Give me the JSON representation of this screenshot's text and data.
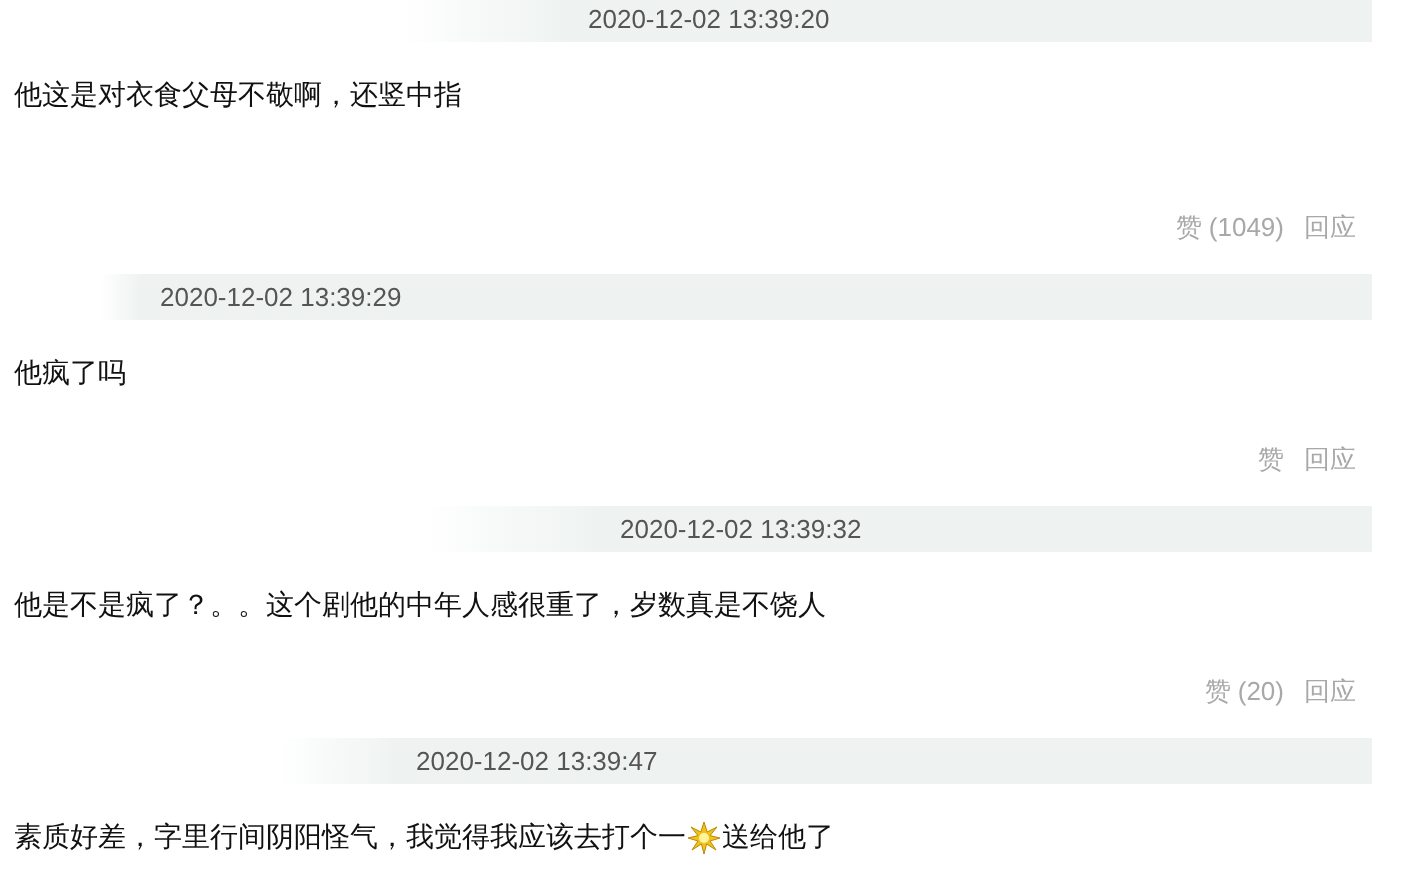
{
  "comments": [
    {
      "time": "2020-12-02 13:39:20",
      "segments": [
        {
          "kind": "text",
          "text": "他这是对衣食父母不敬啊，还竖中指"
        }
      ],
      "likes": "赞 (1049)",
      "reply": "回应"
    },
    {
      "time": "2020-12-02 13:39:29",
      "segments": [
        {
          "kind": "text",
          "text": "他疯了吗"
        }
      ],
      "likes": "赞",
      "reply": "回应"
    },
    {
      "time": "2020-12-02 13:39:32",
      "segments": [
        {
          "kind": "text",
          "text": "他是不是疯了？。。这个剧他的中年人感很重了，岁数真是不饶人"
        }
      ],
      "likes": "赞 (20)",
      "reply": "回应"
    },
    {
      "time": "2020-12-02 13:39:47",
      "segments": [
        {
          "kind": "text",
          "text": "素质好差，字里行间阴阳怪气，我觉得我应该去打个一"
        },
        {
          "kind": "emoji"
        },
        {
          "kind": "text",
          "text": "送给他了"
        }
      ]
    }
  ]
}
